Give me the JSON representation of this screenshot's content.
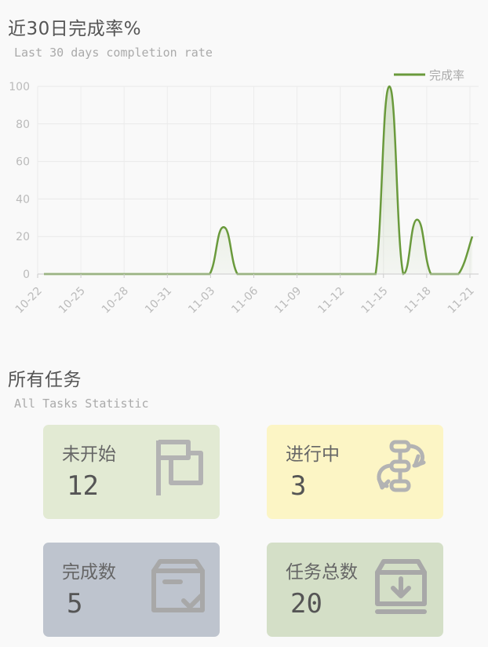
{
  "chart_section": {
    "title": "近30日完成率%",
    "subtitle": "Last 30 days completion rate"
  },
  "chart_data": {
    "type": "line",
    "title": "近30日完成率%",
    "series": [
      {
        "name": "完成率",
        "color": "#6a9a3c",
        "x": [
          "10-22",
          "10-23",
          "10-24",
          "10-25",
          "10-26",
          "10-27",
          "10-28",
          "10-29",
          "10-30",
          "10-31",
          "11-01",
          "11-02",
          "11-03",
          "11-04",
          "11-05",
          "11-06",
          "11-07",
          "11-08",
          "11-09",
          "11-10",
          "11-11",
          "11-12",
          "11-13",
          "11-14",
          "11-15",
          "11-16",
          "11-17",
          "11-18",
          "11-19",
          "11-20",
          "11-21",
          "11-22"
        ],
        "values": [
          0,
          0,
          0,
          0,
          0,
          0,
          0,
          0,
          0,
          0,
          0,
          0,
          0,
          25,
          0,
          0,
          0,
          0,
          0,
          0,
          0,
          0,
          0,
          0,
          0,
          100,
          0,
          29,
          0,
          0,
          0,
          20
        ]
      }
    ],
    "x_tick_labels": [
      "10-22",
      "10-25",
      "10-28",
      "10-31",
      "11-03",
      "11-06",
      "11-09",
      "11-12",
      "11-15",
      "11-18",
      "11-21"
    ],
    "y_ticks": [
      0,
      20,
      40,
      60,
      80,
      100
    ],
    "ylim": [
      0,
      100
    ],
    "grid": true,
    "legend_position": "top-right"
  },
  "tasks_section": {
    "title": "所有任务",
    "subtitle": "All Tasks Statistic"
  },
  "cards": [
    {
      "label": "未开始",
      "value": "12",
      "icon": "flag-icon",
      "bg": "#e2ead3"
    },
    {
      "label": "进行中",
      "value": "3",
      "icon": "workflow-icon",
      "bg": "#fcf5c5"
    },
    {
      "label": "完成数",
      "value": "5",
      "icon": "box-check-icon",
      "bg": "#bec4ce"
    },
    {
      "label": "任务总数",
      "value": "20",
      "icon": "archive-download-icon",
      "bg": "#d4dfc7"
    }
  ]
}
